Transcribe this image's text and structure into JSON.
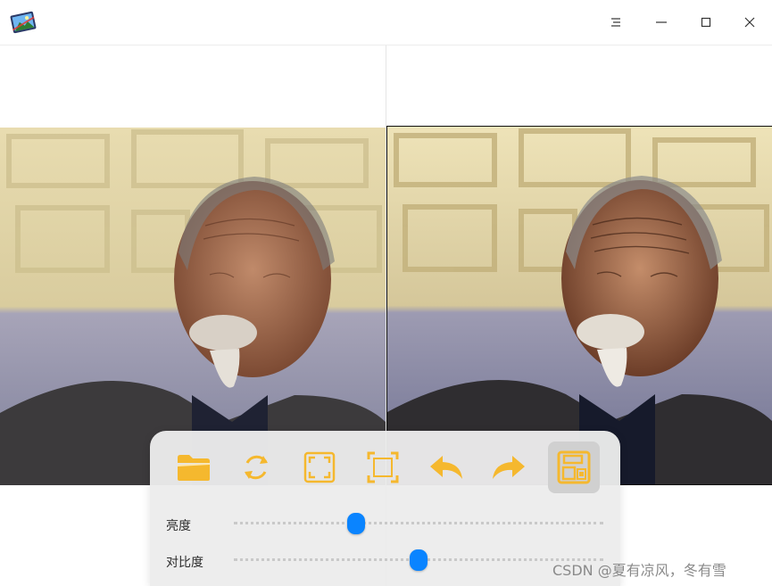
{
  "titlebar": {
    "app_icon": "photo-editor-logo",
    "buttons": [
      "menu-icon",
      "minimize-icon",
      "maximize-icon",
      "close-icon"
    ]
  },
  "images": {
    "left": "portrait of elderly man (original)",
    "right": "portrait of elderly man (enhanced)"
  },
  "toolbar": {
    "accent_color": "#f5b82e",
    "tools": [
      {
        "icon": "open-folder-icon",
        "active": false
      },
      {
        "icon": "rotate-icon",
        "active": false
      },
      {
        "icon": "fit-window-icon",
        "active": false
      },
      {
        "icon": "crop-icon",
        "active": false
      },
      {
        "icon": "undo-icon",
        "active": false
      },
      {
        "icon": "redo-icon",
        "active": false
      },
      {
        "icon": "save-icon",
        "active": true
      }
    ],
    "sliders": [
      {
        "label": "亮度",
        "value": 0.33
      },
      {
        "label": "对比度",
        "value": 0.5
      }
    ],
    "slider_color": "#0a84ff"
  },
  "watermark": "CSDN @夏有凉风，冬有雪"
}
